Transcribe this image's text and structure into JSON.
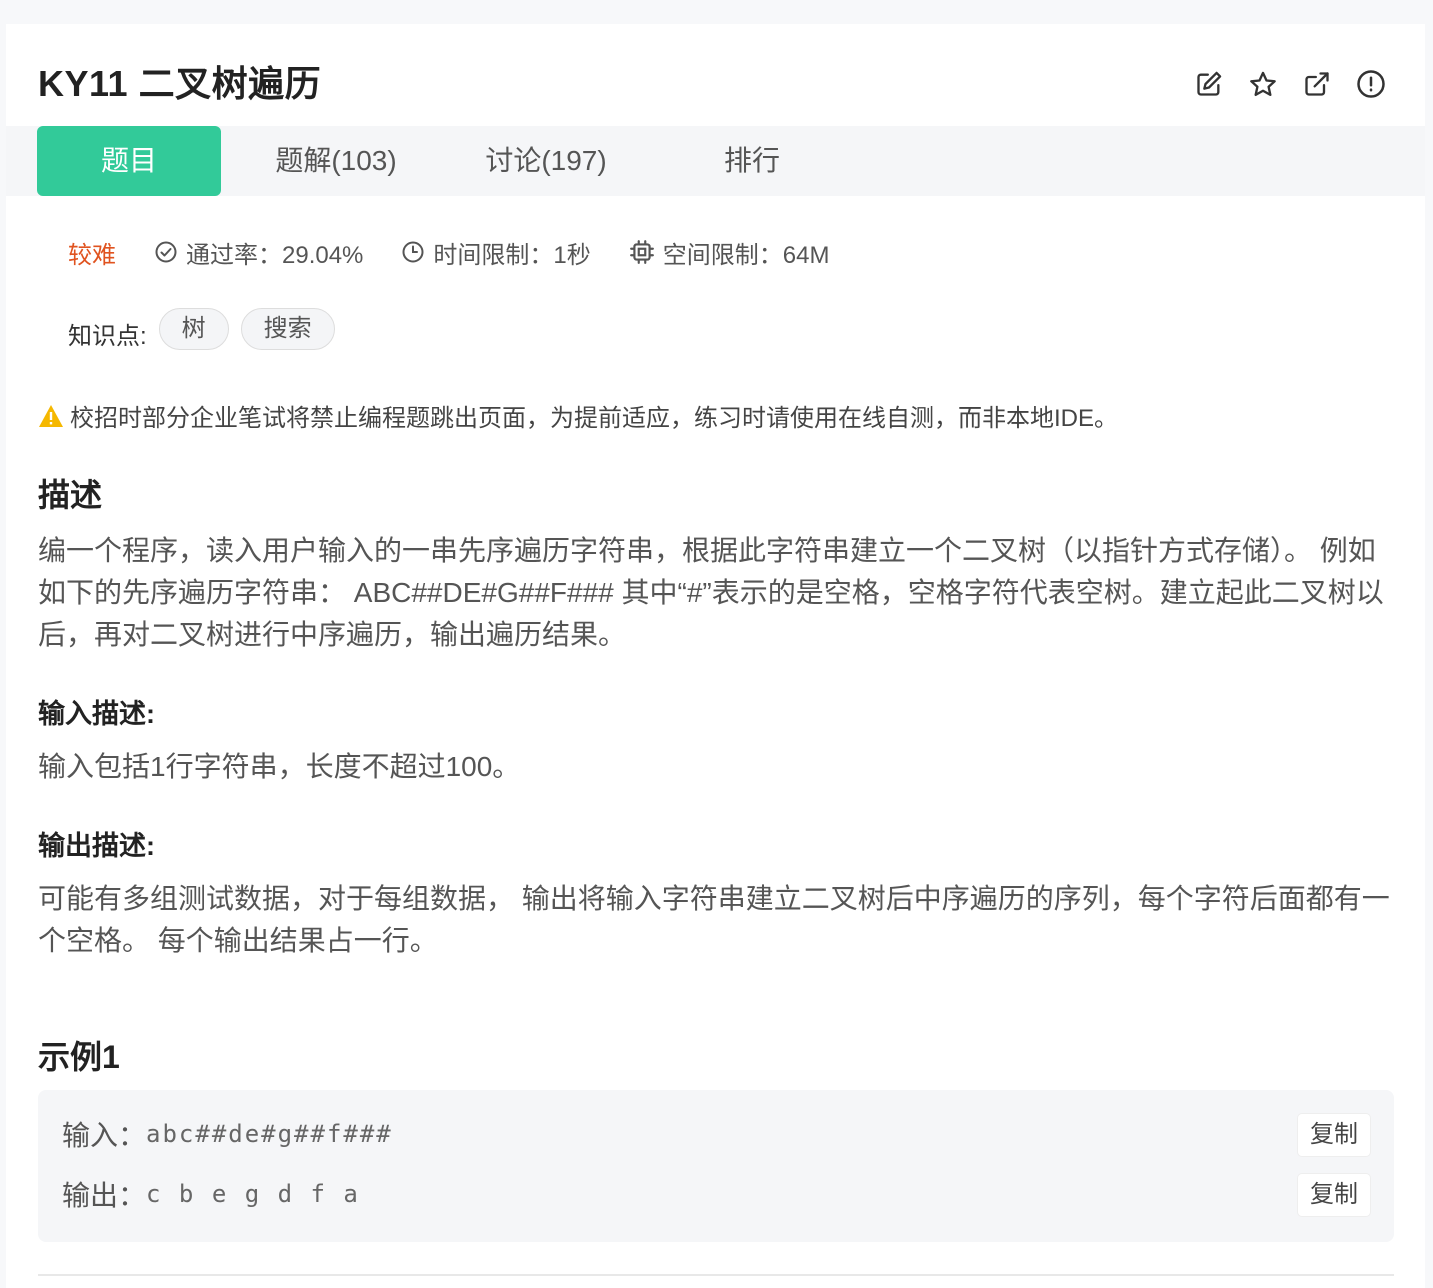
{
  "problem": {
    "title": "KY11  二叉树遍历"
  },
  "tabs": [
    {
      "label": "题目",
      "active": true
    },
    {
      "label": "题解(103)",
      "active": false
    },
    {
      "label": "讨论(197)",
      "active": false
    },
    {
      "label": "排行",
      "active": false
    }
  ],
  "meta": {
    "difficulty": "较难",
    "pass_rate": "通过率：29.04%",
    "time_limit": "时间限制：1秒",
    "memory_limit": "空间限制：64M"
  },
  "knowledge": {
    "label": "知识点:",
    "tags": [
      "树",
      "搜索"
    ]
  },
  "warning": "校招时部分企业笔试将禁止编程题跳出页面，为提前适应，练习时请使用在线自测，而非本地IDE。",
  "description": {
    "title": "描述",
    "text": "编一个程序，读入用户输入的一串先序遍历字符串，根据此字符串建立一个二叉树（以指针方式存储）。 例如如下的先序遍历字符串： ABC##DE#G##F### 其中“#”表示的是空格，空格字符代表空树。建立起此二叉树以后，再对二叉树进行中序遍历，输出遍历结果。"
  },
  "input_desc": {
    "title": "输入描述:",
    "text": "输入包括1行字符串，长度不超过100。"
  },
  "output_desc": {
    "title": "输出描述:",
    "text": "可能有多组测试数据，对于每组数据， 输出将输入字符串建立二叉树后中序遍历的序列，每个字符后面都有一个空格。 每个输出结果占一行。"
  },
  "example": {
    "title": "示例1",
    "input_label": "输入：",
    "input_value": "abc##de#g##f###",
    "output_label": "输出：",
    "output_value": "c b e g d f a",
    "copy_label": "复制"
  },
  "icons": {
    "edit": "edit-icon",
    "star": "star-icon",
    "share": "external-link-icon",
    "report": "alert-circle-icon"
  },
  "colors": {
    "accent": "#32ca99",
    "difficulty": "#e0531f",
    "warning": "#f5b800"
  }
}
